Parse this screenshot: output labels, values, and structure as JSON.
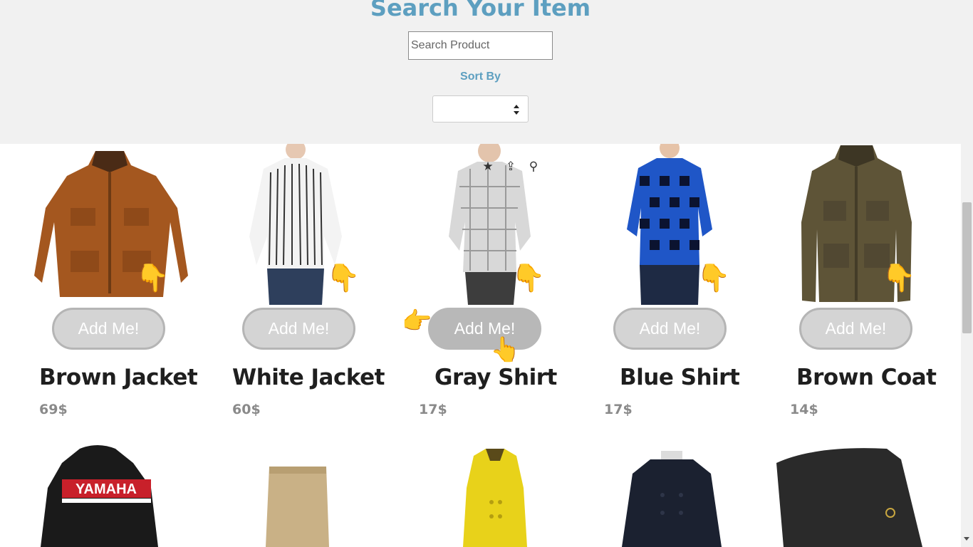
{
  "header": {
    "title": "Search Your Item",
    "search_placeholder": "Search Product",
    "sort_label": "Sort By",
    "sort_selected": ""
  },
  "products": [
    {
      "name": "Brown Jacket",
      "price": "69$",
      "button": "Add Me!"
    },
    {
      "name": "White Jacket",
      "price": "60$",
      "button": "Add Me!"
    },
    {
      "name": "Gray Shirt",
      "price": "17$",
      "button": "Add Me!"
    },
    {
      "name": "Blue Shirt",
      "price": "17$",
      "button": "Add Me!"
    },
    {
      "name": "Brown Coat",
      "price": "14$",
      "button": "Add Me!"
    }
  ],
  "row2_products": [
    {
      "brand_text": "YAMAHA"
    },
    {},
    {},
    {},
    {}
  ],
  "icons": {
    "favorite": "star-icon",
    "share": "share-icon",
    "search": "search-icon",
    "pointer": "pointing-hand-icon"
  },
  "colors": {
    "accent": "#5d9fc0",
    "header_bg": "#f1f1f1",
    "button_bg": "#d4d4d4",
    "price": "#8a8a8a"
  }
}
